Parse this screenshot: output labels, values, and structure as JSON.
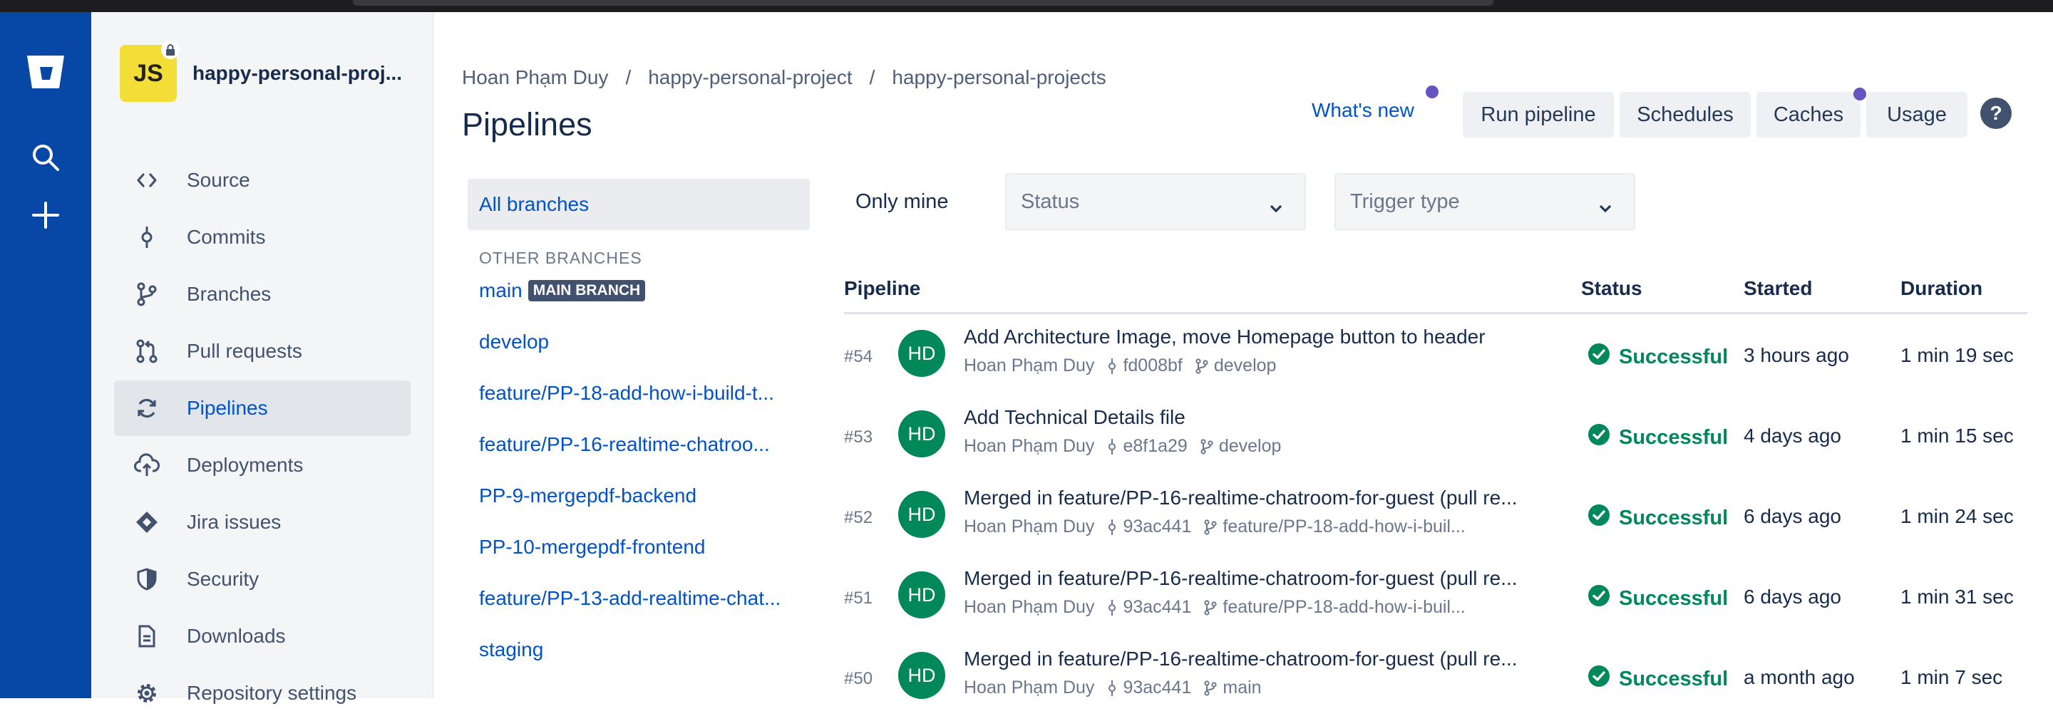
{
  "colors": {
    "global_nav": "#0747a6",
    "link": "#0052cc",
    "success": "#00875a",
    "avatar_bg": "#00875a",
    "repo_avatar": "#f3dd37",
    "dot": "#6554c0"
  },
  "global_nav": {
    "icons": [
      "bitbucket-logo-icon",
      "search-icon",
      "plus-icon"
    ]
  },
  "repo": {
    "avatar_text": "JS",
    "name": "happy-personal-proj..."
  },
  "sidebar": {
    "items": [
      {
        "label": "Source",
        "icon": "code-icon"
      },
      {
        "label": "Commits",
        "icon": "commit-icon"
      },
      {
        "label": "Branches",
        "icon": "branch-icon"
      },
      {
        "label": "Pull requests",
        "icon": "pull-request-icon"
      },
      {
        "label": "Pipelines",
        "icon": "pipelines-icon",
        "active": true
      },
      {
        "label": "Deployments",
        "icon": "cloud-upload-icon"
      },
      {
        "label": "Jira issues",
        "icon": "jira-icon"
      },
      {
        "label": "Security",
        "icon": "shield-icon"
      },
      {
        "label": "Downloads",
        "icon": "document-icon"
      },
      {
        "label": "Repository settings",
        "icon": "gear-icon"
      }
    ]
  },
  "breadcrumb": [
    "Hoan Phạm Duy",
    "happy-personal-project",
    "happy-personal-projects"
  ],
  "breadcrumb_sep": "/",
  "page_title": "Pipelines",
  "header_actions": {
    "whats_new": "What's new",
    "run_pipeline": "Run pipeline",
    "schedules": "Schedules",
    "caches": "Caches",
    "usage": "Usage",
    "help": "?"
  },
  "branches": {
    "all": "All branches",
    "other_title": "OTHER BRANCHES",
    "main_badge": "MAIN BRANCH",
    "list": [
      "main",
      "develop",
      "feature/PP-18-add-how-i-build-t...",
      "feature/PP-16-realtime-chatroo...",
      "PP-9-mergepdf-backend",
      "PP-10-mergepdf-frontend",
      "feature/PP-13-add-realtime-chat...",
      "staging"
    ]
  },
  "filters": {
    "only_mine": "Only mine",
    "status_placeholder": "Status",
    "trigger_placeholder": "Trigger type"
  },
  "table": {
    "headers": {
      "pipeline": "Pipeline",
      "status": "Status",
      "started": "Started",
      "duration": "Duration"
    },
    "rows": [
      {
        "num": "#54",
        "avatar": "HD",
        "message": "Add Architecture Image, move Homepage button to header",
        "author": "Hoan Phạm Duy",
        "commit": "fd008bf",
        "branch": "develop",
        "status": "Successful",
        "started": "3 hours ago",
        "duration": "1 min 19 sec"
      },
      {
        "num": "#53",
        "avatar": "HD",
        "message": "Add Technical Details file",
        "author": "Hoan Phạm Duy",
        "commit": "e8f1a29",
        "branch": "develop",
        "status": "Successful",
        "started": "4 days ago",
        "duration": "1 min 15 sec"
      },
      {
        "num": "#52",
        "avatar": "HD",
        "message": "Merged in feature/PP-16-realtime-chatroom-for-guest (pull re...",
        "author": "Hoan Phạm Duy",
        "commit": "93ac441",
        "branch": "feature/PP-18-add-how-i-buil...",
        "status": "Successful",
        "started": "6 days ago",
        "duration": "1 min 24 sec"
      },
      {
        "num": "#51",
        "avatar": "HD",
        "message": "Merged in feature/PP-16-realtime-chatroom-for-guest (pull re...",
        "author": "Hoan Phạm Duy",
        "commit": "93ac441",
        "branch": "feature/PP-18-add-how-i-buil...",
        "status": "Successful",
        "started": "6 days ago",
        "duration": "1 min 31 sec"
      },
      {
        "num": "#50",
        "avatar": "HD",
        "message": "Merged in feature/PP-16-realtime-chatroom-for-guest (pull re...",
        "author": "Hoan Phạm Duy",
        "commit": "93ac441",
        "branch": "main",
        "status": "Successful",
        "started": "a month ago",
        "duration": "1 min 7 sec"
      }
    ]
  }
}
